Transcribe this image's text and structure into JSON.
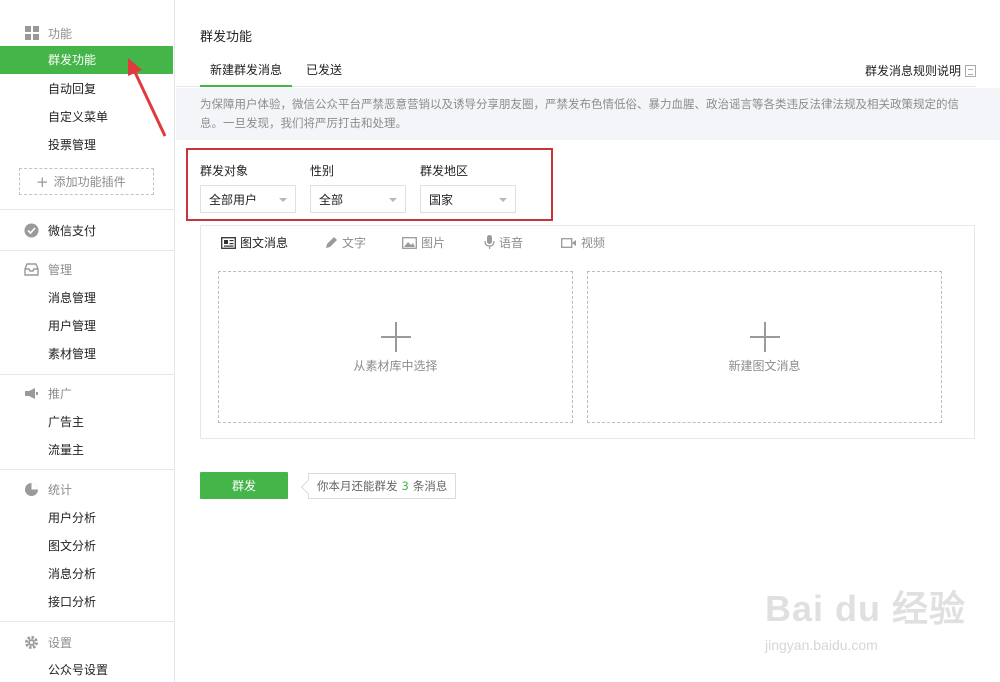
{
  "sidebar": {
    "sections": [
      {
        "icon": "grid-icon",
        "label": "功能"
      },
      {
        "icon": "wechat-pay-icon",
        "label": "微信支付"
      },
      {
        "icon": "inbox-icon",
        "label": "管理"
      },
      {
        "icon": "megaphone-icon",
        "label": "推广"
      },
      {
        "icon": "pie-chart-icon",
        "label": "统计"
      },
      {
        "icon": "gear-icon",
        "label": "设置"
      }
    ],
    "function_items": [
      "群发功能",
      "自动回复",
      "自定义菜单",
      "投票管理"
    ],
    "add_plugin": "添加功能插件",
    "manage_items": [
      "消息管理",
      "用户管理",
      "素材管理"
    ],
    "promo_items": [
      "广告主",
      "流量主"
    ],
    "stats_items": [
      "用户分析",
      "图文分析",
      "消息分析",
      "接口分析"
    ],
    "settings_items": [
      "公众号设置"
    ],
    "active_item": "群发功能"
  },
  "main": {
    "title": "群发功能",
    "tabs": [
      "新建群发消息",
      "已发送"
    ],
    "rules_link": "群发消息规则说明",
    "notice": "为保障用户体验，微信公众平台严禁恶意营销以及诱导分享朋友圈，严禁发布色情低俗、暴力血腥、政治谣言等各类违反法律法规及相关政策规定的信息。一旦发现，我们将严厉打击和处理。",
    "filters": [
      {
        "label": "群发对象",
        "value": "全部用户"
      },
      {
        "label": "性别",
        "value": "全部"
      },
      {
        "label": "群发地区",
        "value": "国家"
      }
    ],
    "editor_tabs": [
      {
        "icon": "news-icon",
        "label": "图文消息"
      },
      {
        "icon": "pencil-icon",
        "label": "文字"
      },
      {
        "icon": "image-icon",
        "label": "图片"
      },
      {
        "icon": "mic-icon",
        "label": "语音"
      },
      {
        "icon": "video-icon",
        "label": "视频"
      }
    ],
    "cards": [
      "从素材库中选择",
      "新建图文消息"
    ],
    "send_button": "群发",
    "quota": {
      "prefix": "你本月还能群发",
      "count": "3",
      "suffix": "条消息"
    }
  },
  "watermark": {
    "main": "Bai du 经验",
    "sub": "jingyan.baidu.com"
  },
  "colors": {
    "accent": "#44b549",
    "highlight_box": "#c9343a",
    "notice_bg": "#f4f5f9"
  }
}
